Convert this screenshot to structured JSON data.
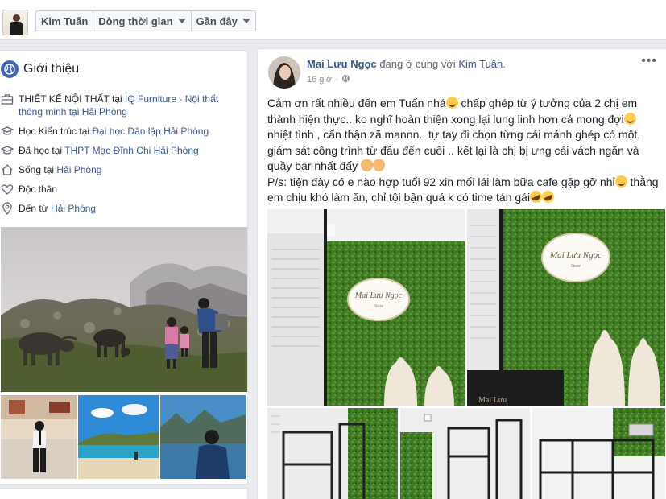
{
  "header": {
    "tabs": [
      {
        "label": "Kim Tuấn",
        "has_caret": false
      },
      {
        "label": "Dòng thời gian",
        "has_caret": true
      },
      {
        "label": "Gần đây",
        "has_caret": true
      }
    ]
  },
  "intro": {
    "title": "Giới thiệu",
    "items": [
      {
        "icon": "briefcase-icon",
        "text": "THIẾT KẾ NỘI THẤT tại ",
        "link": "IQ Furniture - Nội thất thông minh tại Hải Phòng"
      },
      {
        "icon": "graduation-cap-icon",
        "text": "Học Kiến trúc tại ",
        "link": "Đại học Dân lập Hải Phòng"
      },
      {
        "icon": "graduation-cap-icon",
        "text": "Đã học tại ",
        "link": "THPT Mạc Đĩnh Chi Hải Phòng"
      },
      {
        "icon": "home-icon",
        "text": "Sống tại ",
        "link": "Hải Phòng"
      },
      {
        "icon": "heart-icon",
        "text": "Độc thân",
        "link": ""
      },
      {
        "icon": "location-pin-icon",
        "text": "Đến từ ",
        "link": "Hải Phòng"
      }
    ]
  },
  "post": {
    "author": "Mai Lưu Ngọc",
    "with_text": " đang ở cùng với ",
    "tagged": "Kim Tuấn",
    "after_tag": ".",
    "time": "16 giờ",
    "privacy_sep": "·",
    "more": "•••",
    "body": {
      "p1a": "Cảm ơn rất nhiều đến em Tuấn nhá",
      "p1b": " chấp ghép từ ý tưởng của 2 chị em thành hiện thực.. ko nghĩ hoàn thiện xong lại lung linh hơn cả mong đợi",
      "p1c": " nhiệt tình , cẩn thận zã mannn.. tự tay đi chọn từng cái mảnh ghép cỏ một, giám sát công trình từ đầu đến cuối .. kết lại là chị bị ưng cái vách ngăn và quầy bar nhất đấy ",
      "p2a": "P/s: tiện đây có e nào hợp tuổi 92 xin mối lái làm bữa cafe gặp gỡ nhỉ",
      "p2b": " thằng em chịu khó làm ăn, chỉ tội bận quá k có time tán gái"
    },
    "sign_text": "Mai Lưu Ngọc",
    "sign_sub": "Store",
    "sign_text_small": "Mai Lưu Ngọc",
    "sign_sub_small": "Store",
    "bar_text": "Mai Lưu"
  },
  "colors": {
    "brand": "#4267b2",
    "link": "#365899",
    "bg": "#e9ebee"
  }
}
